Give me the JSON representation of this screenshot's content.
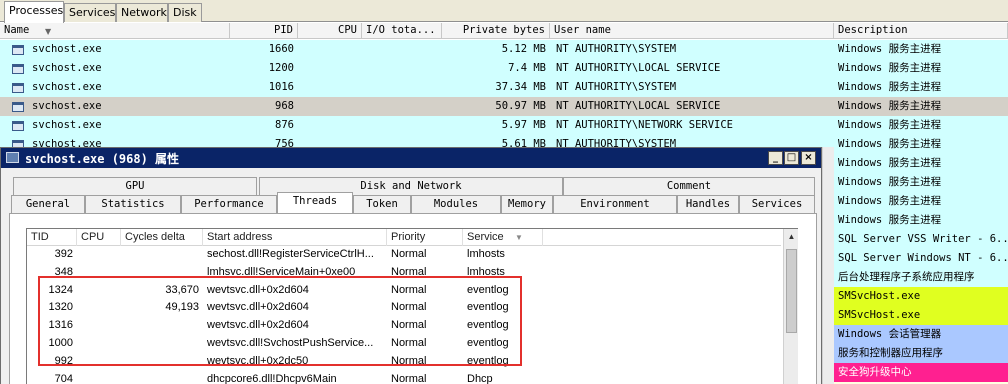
{
  "top_tabs": [
    "Processes",
    "Services",
    "Network",
    "Disk"
  ],
  "columns": {
    "name": "Name",
    "pid": "PID",
    "cpu": "CPU",
    "io": "I/O tota...",
    "private": "Private bytes",
    "user": "User name",
    "desc": "Description"
  },
  "processes": [
    {
      "name": "svchost.exe",
      "pid": "1660",
      "private": "5.12 MB",
      "user": "NT AUTHORITY\\SYSTEM"
    },
    {
      "name": "svchost.exe",
      "pid": "1200",
      "private": "7.4 MB",
      "user": "NT AUTHORITY\\LOCAL SERVICE"
    },
    {
      "name": "svchost.exe",
      "pid": "1016",
      "private": "37.34 MB",
      "user": "NT AUTHORITY\\SYSTEM"
    },
    {
      "name": "svchost.exe",
      "pid": "968",
      "private": "50.97 MB",
      "user": "NT AUTHORITY\\LOCAL SERVICE"
    },
    {
      "name": "svchost.exe",
      "pid": "876",
      "private": "5.97 MB",
      "user": "NT AUTHORITY\\NETWORK SERVICE"
    },
    {
      "name": "svchost.exe",
      "pid": "756",
      "private": "5.61 MB",
      "user": "NT AUTHORITY\\SYSTEM"
    }
  ],
  "descriptions": [
    "Windows 服务主进程",
    "Windows 服务主进程",
    "Windows 服务主进程",
    "Windows 服务主进程",
    "Windows 服务主进程",
    "Windows 服务主进程",
    "Windows 服务主进程",
    "Windows 服务主进程",
    "Windows 服务主进程",
    "Windows 服务主进程",
    "SQL Server VSS Writer - 6...",
    "SQL Server Windows NT - 6...",
    "后台处理程序子系统应用程序",
    "SMSvcHost.exe",
    "SMSvcHost.exe",
    "Windows 会话管理器",
    "服务和控制器应用程序",
    "安全狗升级中心",
    ""
  ],
  "dialog": {
    "title": "svchost.exe (968) 属性",
    "tabs_row1": [
      "GPU",
      "Disk and Network",
      "Comment"
    ],
    "tabs_row2": [
      "General",
      "Statistics",
      "Performance",
      "Threads",
      "Token",
      "Modules",
      "Memory",
      "Environment",
      "Handles",
      "Services"
    ],
    "thread_columns": {
      "tid": "TID",
      "cpu": "CPU",
      "cycles": "Cycles delta",
      "start": "Start address",
      "priority": "Priority",
      "service": "Service"
    },
    "threads": [
      {
        "tid": "392",
        "cpu": "",
        "cycles": "",
        "start": "sechost.dll!RegisterServiceCtrlH...",
        "priority": "Normal",
        "service": "lmhosts"
      },
      {
        "tid": "348",
        "cpu": "",
        "cycles": "",
        "start": "lmhsvc.dll!ServiceMain+0xe00",
        "priority": "Normal",
        "service": "lmhosts"
      },
      {
        "tid": "1324",
        "cpu": "",
        "cycles": "33,670",
        "start": "wevtsvc.dll+0x2d604",
        "priority": "Normal",
        "service": "eventlog"
      },
      {
        "tid": "1320",
        "cpu": "",
        "cycles": "49,193",
        "start": "wevtsvc.dll+0x2d604",
        "priority": "Normal",
        "service": "eventlog"
      },
      {
        "tid": "1316",
        "cpu": "",
        "cycles": "",
        "start": "wevtsvc.dll+0x2d604",
        "priority": "Normal",
        "service": "eventlog"
      },
      {
        "tid": "1000",
        "cpu": "",
        "cycles": "",
        "start": "wevtsvc.dll!SvchostPushService...",
        "priority": "Normal",
        "service": "eventlog"
      },
      {
        "tid": "992",
        "cpu": "",
        "cycles": "",
        "start": "wevtsvc.dll+0x2dc50",
        "priority": "Normal",
        "service": "eventlog"
      },
      {
        "tid": "704",
        "cpu": "",
        "cycles": "",
        "start": "dhcpcore6.dll!Dhcpv6Main",
        "priority": "Normal",
        "service": "Dhcp"
      }
    ]
  },
  "colors": {
    "service_row": "#d0ffff",
    "selected_row": "#d4d0c8",
    "sms_row": "#e0ff20",
    "blue_row": "#aac8ff",
    "pink_row": "#ff2090",
    "highlight_box": "#e3302c",
    "title_bar": "#0a2467"
  }
}
